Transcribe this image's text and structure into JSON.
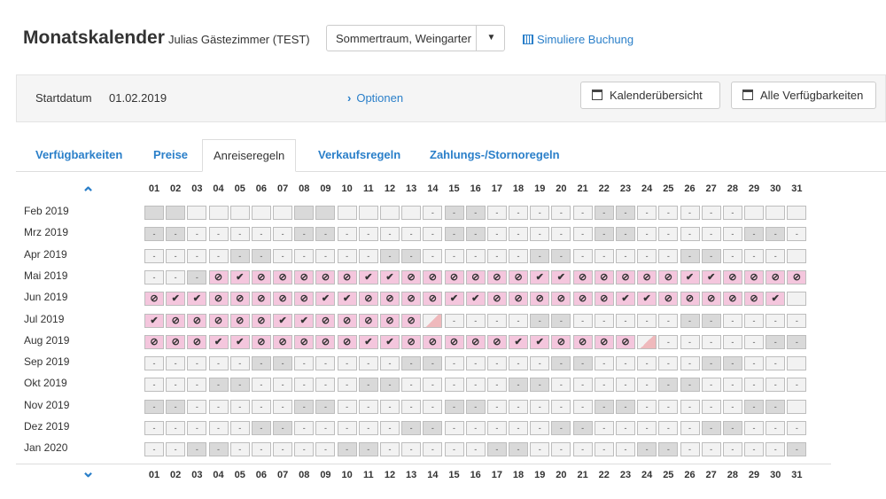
{
  "header": {
    "title": "Monatskalender",
    "property": "Julias Gästezimmer (TEST)",
    "select_value": "Sommertraum, Weingarter",
    "simulate": "Simuliere Buchung"
  },
  "toolbar": {
    "start_label": "Startdatum",
    "start_value": "01.02.2019",
    "options": "Optionen",
    "calendar_overview": "Kalenderübersicht",
    "all_availabilities": "Alle Verfügbarkeiten"
  },
  "tabs": [
    "Verfügbarkeiten",
    "Preise",
    "Anreiseregeln",
    "Verkaufsregeln",
    "Zahlungs-/Stornoregeln"
  ],
  "active_tab": "Anreiseregeln",
  "days": [
    "01",
    "02",
    "03",
    "04",
    "05",
    "06",
    "07",
    "08",
    "09",
    "10",
    "11",
    "12",
    "13",
    "14",
    "15",
    "16",
    "17",
    "18",
    "19",
    "20",
    "21",
    "22",
    "23",
    "24",
    "25",
    "26",
    "27",
    "28",
    "29",
    "30",
    "31"
  ],
  "legend_symbols": {
    "allowed": "✔",
    "blocked": "⊘",
    "none": "-"
  },
  "colors": {
    "pink": "#f4c6dd",
    "grey": "#d9d9d9",
    "light": "#f2f2f2",
    "accent": "#2a7fc9"
  },
  "months": [
    {
      "label": "Feb 2019",
      "cells": "EEEEEEEEEEEEE-------------------"
    },
    {
      "label": "Mrz 2019",
      "cells": "-------------------------------"
    },
    {
      "label": "Apr 2019",
      "cells": "-------------------------------"
    },
    {
      "label": "Mai 2019",
      "cells": "---XVXXXXXVVXXXXXXVVXXXXXVVXXXX"
    },
    {
      "label": "Jun 2019",
      "cells": "XVVXXXXXVVXXXXVVXXXXXXVVXXXXXV-"
    },
    {
      "label": "Jul 2019",
      "cells": "VXXXXXVVXXXXXD-----------------"
    },
    {
      "label": "Aug 2019",
      "cells": "XXXVVXXXXXVVXXXXXVVXXXXD-------"
    },
    {
      "label": "Sep 2019",
      "cells": "-------------------------------"
    },
    {
      "label": "Okt 2019",
      "cells": "-------------------------------"
    },
    {
      "label": "Nov 2019",
      "cells": "-------------------------------"
    },
    {
      "label": "Dez 2019",
      "cells": "-------------------------------"
    },
    {
      "label": "Jan 2020",
      "cells": "-------------------------------"
    }
  ]
}
